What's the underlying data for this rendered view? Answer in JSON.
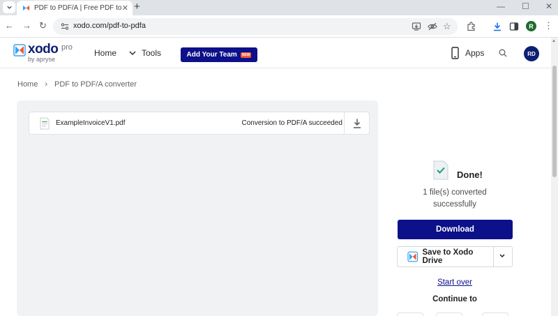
{
  "browser": {
    "tab_title": "PDF to PDF/A | Free PDF to PDF/A Converter",
    "url": "xodo.com/pdf-to-pdfa",
    "profile_initial": "R",
    "icons": [
      "tab-search-icon",
      "close-icon",
      "new-tab-icon",
      "minimize-icon",
      "maximize-icon",
      "window-close-icon",
      "back-icon",
      "forward-icon",
      "reload-icon",
      "site-info-icon",
      "install-app-icon",
      "eye-off-icon",
      "star-icon",
      "extensions-icon",
      "downloads-icon",
      "side-panel-icon",
      "kebab-menu-icon"
    ]
  },
  "header": {
    "logo_word": "xodo",
    "logo_pro": "pro",
    "logo_by": "by apryse",
    "nav_home": "Home",
    "nav_tools": "Tools",
    "team_button": "Add Your Team",
    "team_badge": "NEW",
    "apps_label": "Apps",
    "avatar_initials": "RD",
    "brand_color": "#0c1089"
  },
  "breadcrumb": {
    "home": "Home",
    "separator": "›",
    "current": "PDF to PDF/A converter"
  },
  "file": {
    "name": "ExampleInvoiceV1.pdf",
    "status": "Conversion to PDF/A succeeded"
  },
  "result": {
    "done": "Done!",
    "converted_line1": "1 file(s) converted",
    "converted_line2": "successfully",
    "download_label": "Download",
    "save_label": "Save to Xodo Drive",
    "start_over": "Start over",
    "continue_to": "Continue to"
  }
}
